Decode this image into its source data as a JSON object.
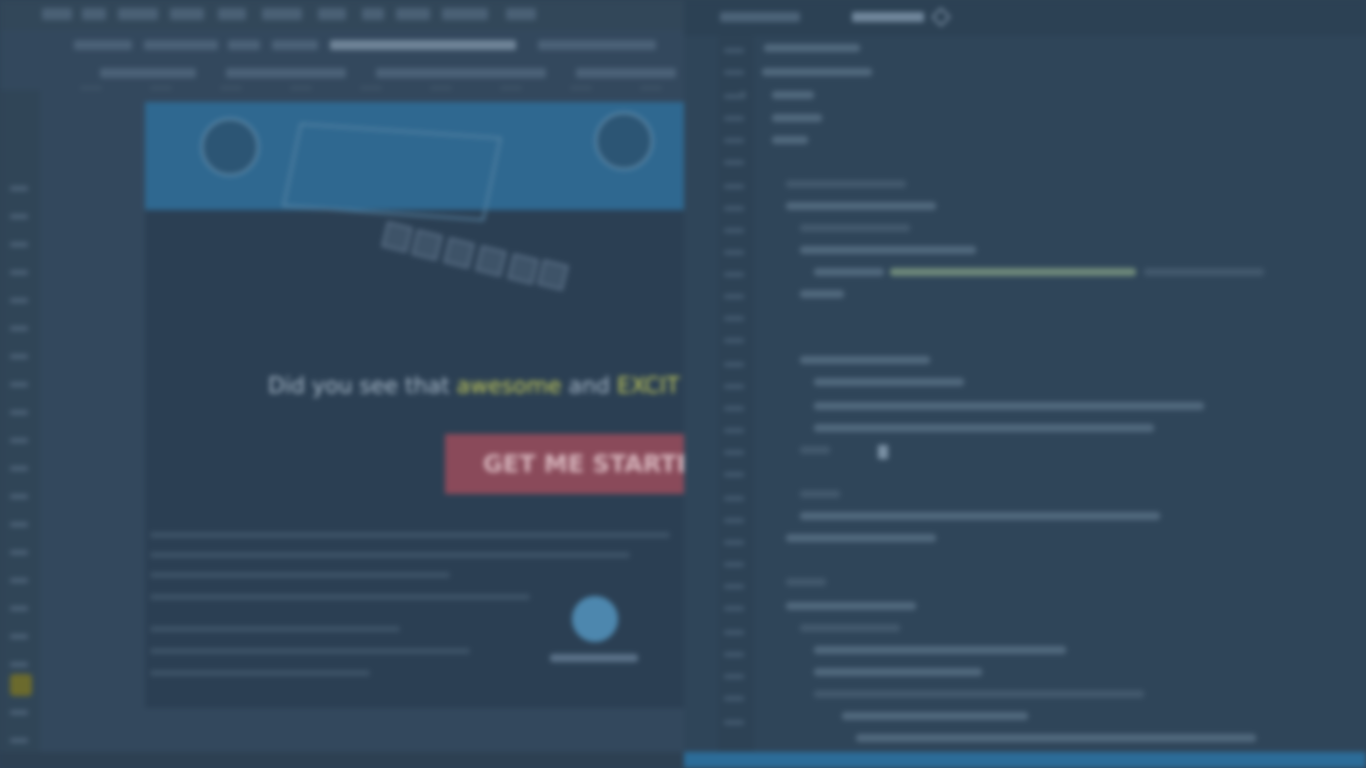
{
  "page_content": {
    "promo": {
      "prefix": "Did you see that",
      "highlight_1": "awesome",
      "connector": "and",
      "highlight_2": "EXCIT"
    },
    "cta_label": "GET ME STARTE"
  },
  "colors": {
    "background": "#2e4256",
    "hero_blue": "#2f6890",
    "cta_red": "#8a4a5a",
    "highlight_yellow": "#c6cc5c",
    "editor_status_blue": "#2c6c98"
  },
  "icons": [
    "close-icon",
    "gutter-warning-icon",
    "avatar-icon"
  ]
}
